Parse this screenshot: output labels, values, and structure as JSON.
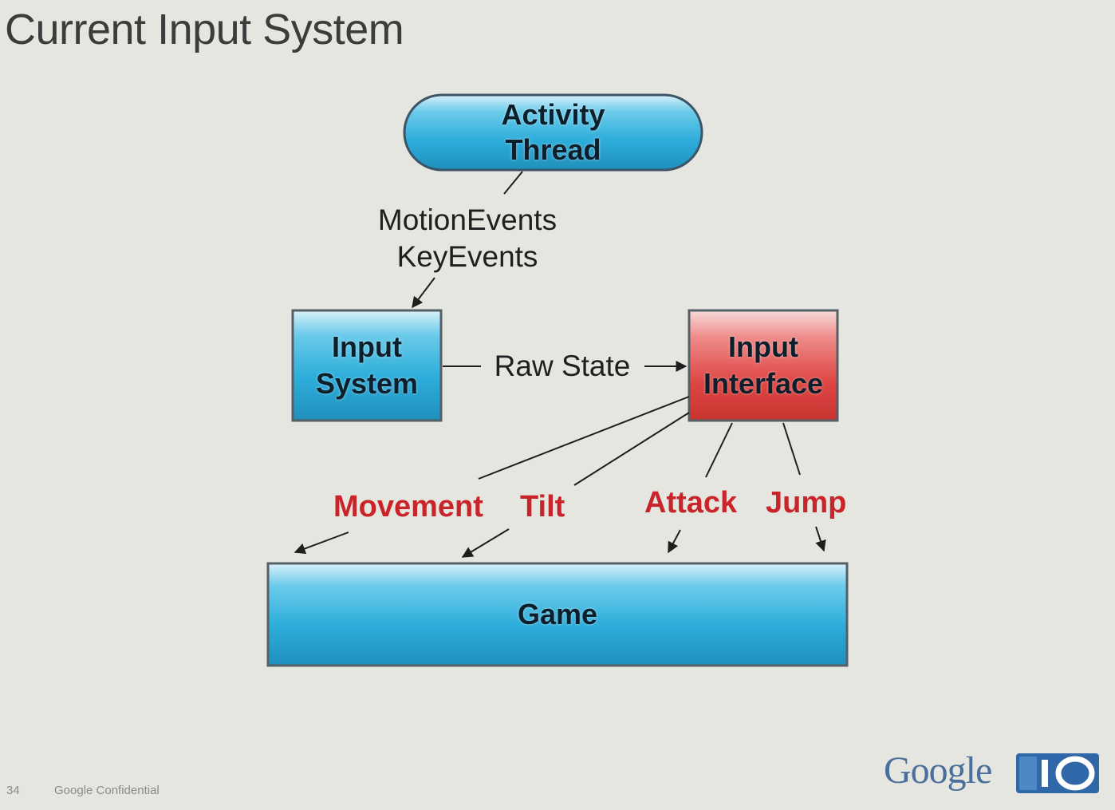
{
  "slide": {
    "title": "Current Input System",
    "page_number": "34",
    "confidential": "Google Confidential"
  },
  "branding": {
    "google": "Google",
    "io_badge": "IO"
  },
  "diagram": {
    "nodes": {
      "activity_thread": "Activity Thread",
      "input_system": "Input System",
      "input_interface": "Input Interface",
      "game": "Game"
    },
    "edges": {
      "motion_events": "MotionEvents",
      "key_events": "KeyEvents",
      "raw_state": "Raw State"
    },
    "events": {
      "movement": "Movement",
      "tilt": "Tilt",
      "attack": "Attack",
      "jump": "Jump"
    }
  },
  "colors": {
    "blue_node": "#3fb6dc",
    "red_node": "#e04a48",
    "event_text": "#c9242a"
  }
}
